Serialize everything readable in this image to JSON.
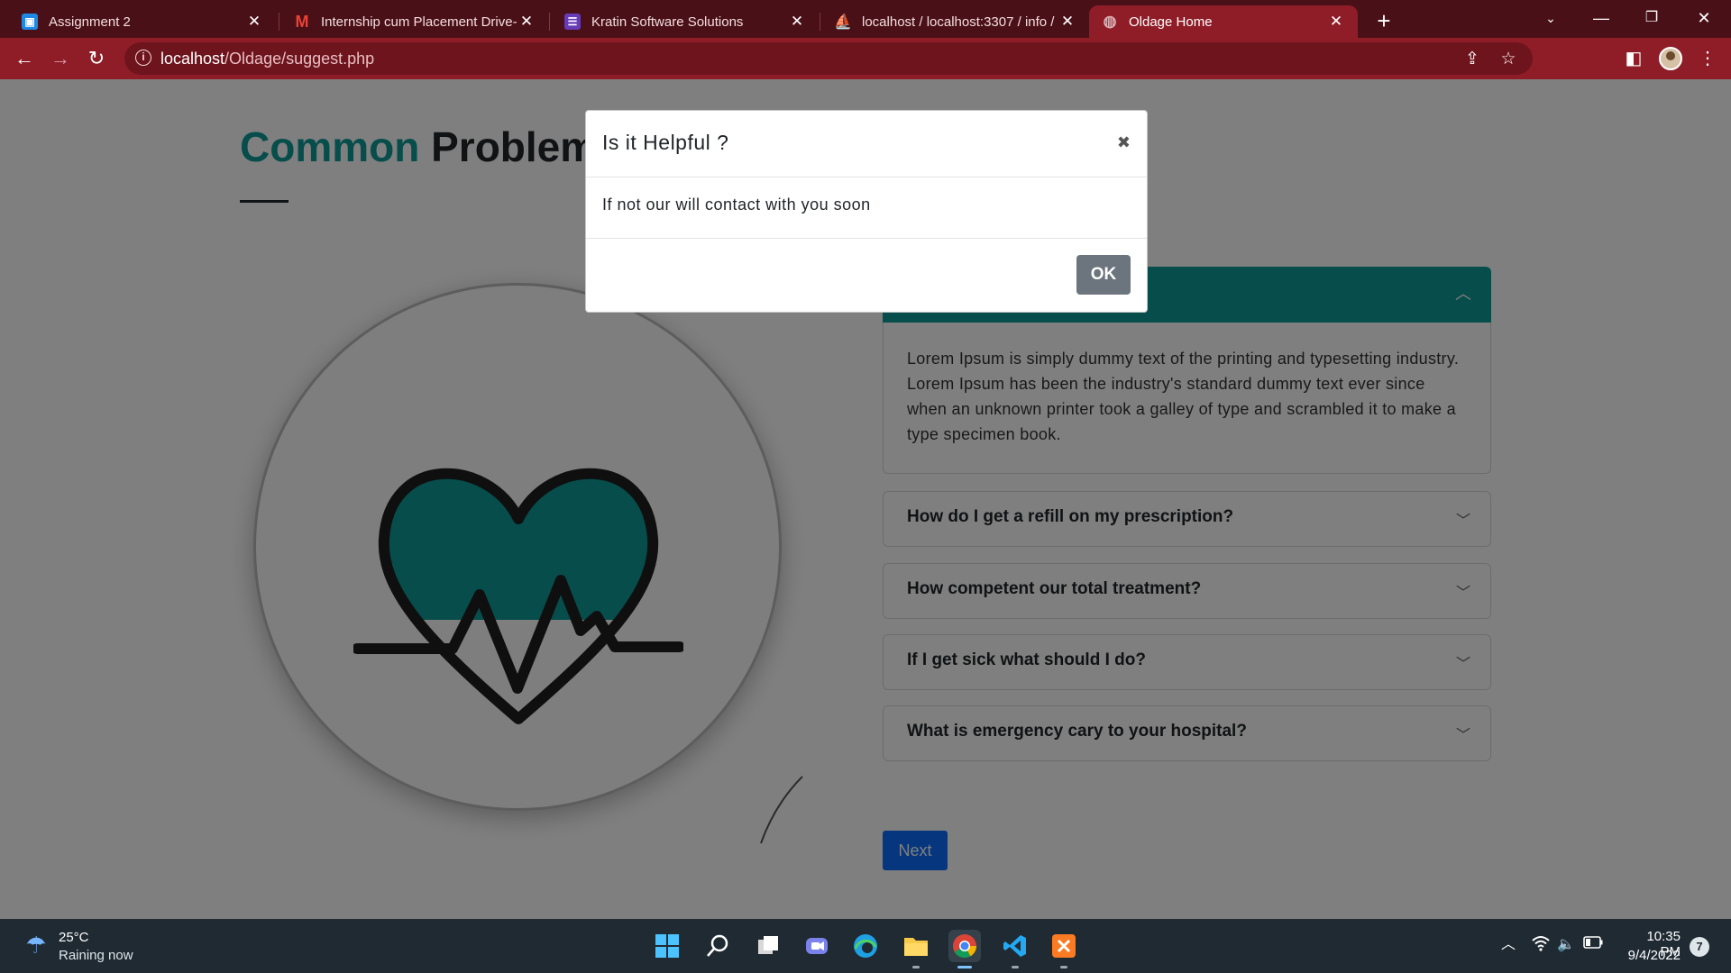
{
  "browser": {
    "tabs": [
      {
        "title": "Assignment 2",
        "icon": "classroom-icon"
      },
      {
        "title": "Internship cum Placement Drive-",
        "icon": "gmail-icon"
      },
      {
        "title": "Kratin Software Solutions",
        "icon": "forms-icon"
      },
      {
        "title": "localhost / localhost:3307 / info /",
        "icon": "phpmyadmin-icon"
      },
      {
        "title": "Oldage Home",
        "icon": "globe-icon"
      }
    ],
    "active_tab": 4,
    "url_host": "localhost",
    "url_path": "/Oldage/suggest.php",
    "theme_color": "#8f1d27"
  },
  "page": {
    "heading_accent": "Common",
    "heading_rest": "Problem S",
    "accent_color": "#0d9b96",
    "faq": {
      "open_answer": "Lorem Ipsum is simply dummy text of the printing and typesetting industry. Lorem Ipsum has been the industry's standard dummy text ever since when an unknown printer took a galley of type and scrambled it to make a type specimen book.",
      "questions": [
        "How do I get a refill on my prescription?",
        "How competent our total treatment?",
        "If I get sick what should I do?",
        "What is emergency cary to your hospital?"
      ]
    },
    "next_label": "Next"
  },
  "modal": {
    "title": "Is it Helpful ?",
    "close_symbol": "✖",
    "body": "If not our will contact with you soon",
    "ok_label": "OK"
  },
  "taskbar": {
    "weather_temp": "25°C",
    "weather_desc": "Raining now",
    "time": "10:35 PM",
    "date": "9/4/2022",
    "notification_count": "7"
  }
}
